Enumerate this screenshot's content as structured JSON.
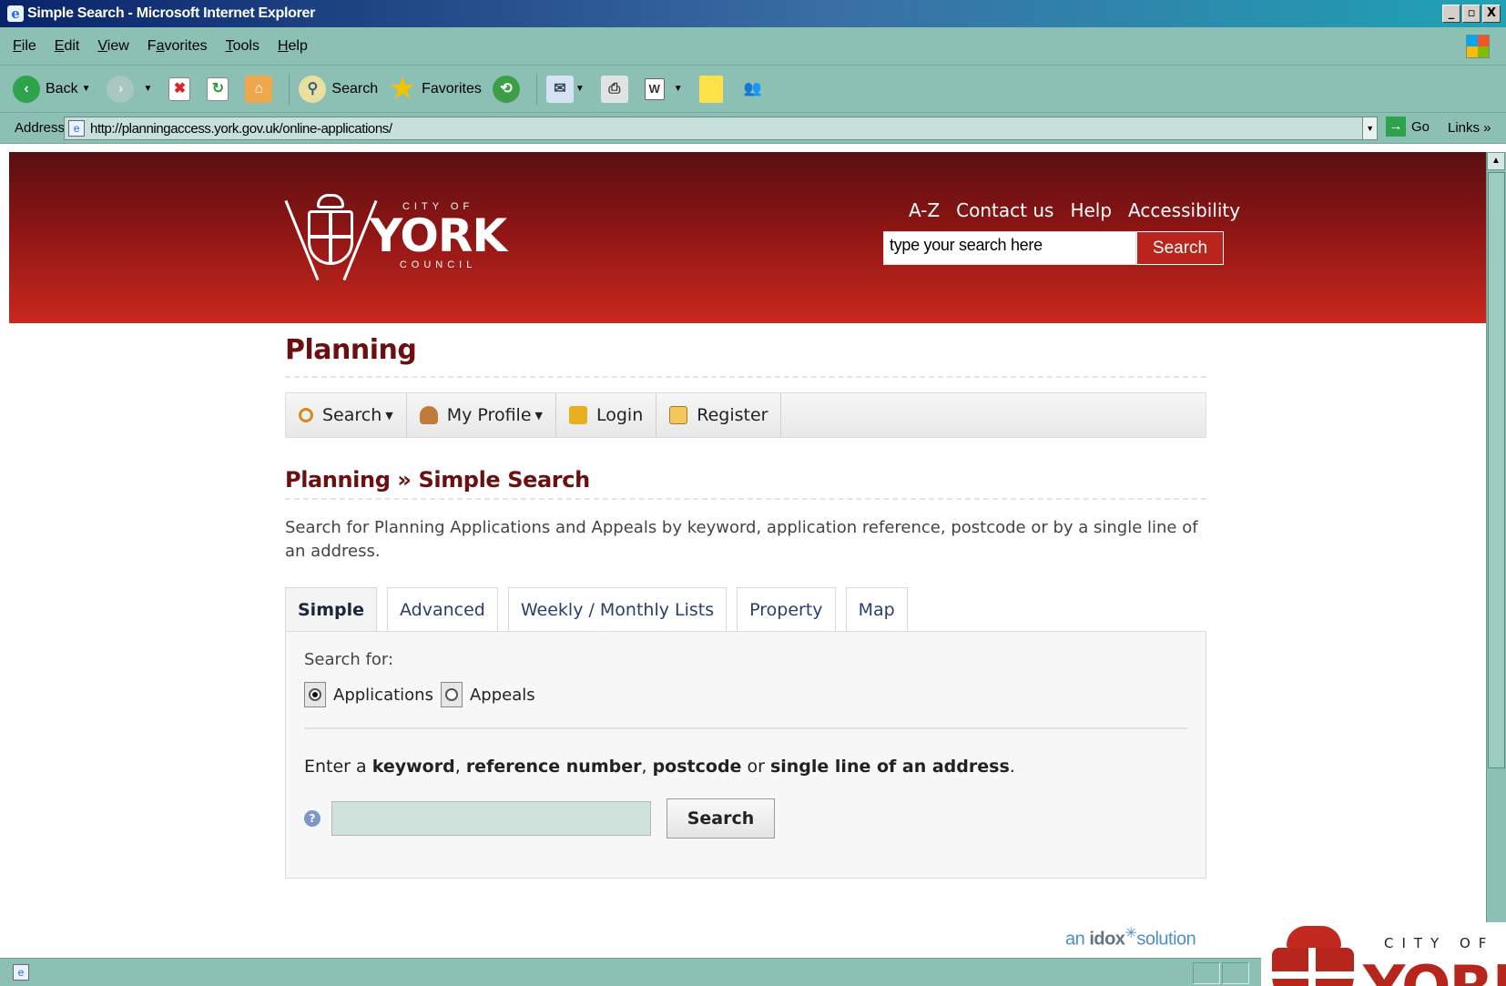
{
  "window": {
    "title": "Simple Search - Microsoft Internet Explorer",
    "controls": [
      "_",
      "▫",
      "X"
    ]
  },
  "menu": [
    {
      "key": "F",
      "rest": "ile"
    },
    {
      "key": "E",
      "rest": "dit"
    },
    {
      "key": "V",
      "rest": "iew"
    },
    {
      "key": "a",
      "pre": "F",
      "rest": "vorites"
    },
    {
      "key": "T",
      "rest": "ools"
    },
    {
      "key": "H",
      "rest": "elp"
    }
  ],
  "toolbar": {
    "back_label": "Back",
    "search_label": "Search",
    "favorites_label": "Favorites"
  },
  "address": {
    "label": "Address",
    "url": "http://planningaccess.york.gov.uk/online-applications/",
    "go_label": "Go",
    "links_label": "Links »"
  },
  "site": {
    "logo_top": "CITY OF",
    "logo_main": "YORK",
    "logo_bottom": "COUNCIL",
    "top_links": [
      "A-Z",
      "Contact us",
      "Help",
      "Accessibility"
    ],
    "search_value": "type your search here",
    "search_button": "Search"
  },
  "page": {
    "heading": "Planning",
    "nav": [
      {
        "label": "Search",
        "icon": "magnifier-icon",
        "dropdown": true
      },
      {
        "label": "My Profile",
        "icon": "user-icon",
        "dropdown": true
      },
      {
        "label": "Login",
        "icon": "padlock-icon",
        "dropdown": false
      },
      {
        "label": "Register",
        "icon": "register-icon",
        "dropdown": false
      }
    ],
    "breadcrumb": "Planning » Simple Search",
    "intro": "Search for Planning Applications and Appeals by keyword, application reference, postcode or by a single line of an address.",
    "tabs": [
      "Simple",
      "Advanced",
      "Weekly / Monthly Lists",
      "Property",
      "Map"
    ],
    "active_tab": "Simple",
    "search_for_label": "Search for:",
    "radio_applications": "Applications",
    "radio_appeals": "Appeals",
    "selected_radio": "Applications",
    "instruction": {
      "p1": "Enter a ",
      "b1": "keyword",
      "p2": ", ",
      "b2": "reference number",
      "p3": ", ",
      "b3": "postcode",
      "p4": " or ",
      "b4": "single line of an address",
      "p5": "."
    },
    "keyword_value": "",
    "search_button": "Search",
    "idox_prefix": "an ",
    "idox_brand": "idox",
    "idox_suffix": "solution"
  },
  "overlay_logo": {
    "top": "CITY OF",
    "main": "YORK"
  },
  "colors": {
    "banner_dark": "#5a0f10",
    "banner_light": "#c9281d",
    "heading": "#6b0f10",
    "chrome": "#8cc0b4"
  }
}
